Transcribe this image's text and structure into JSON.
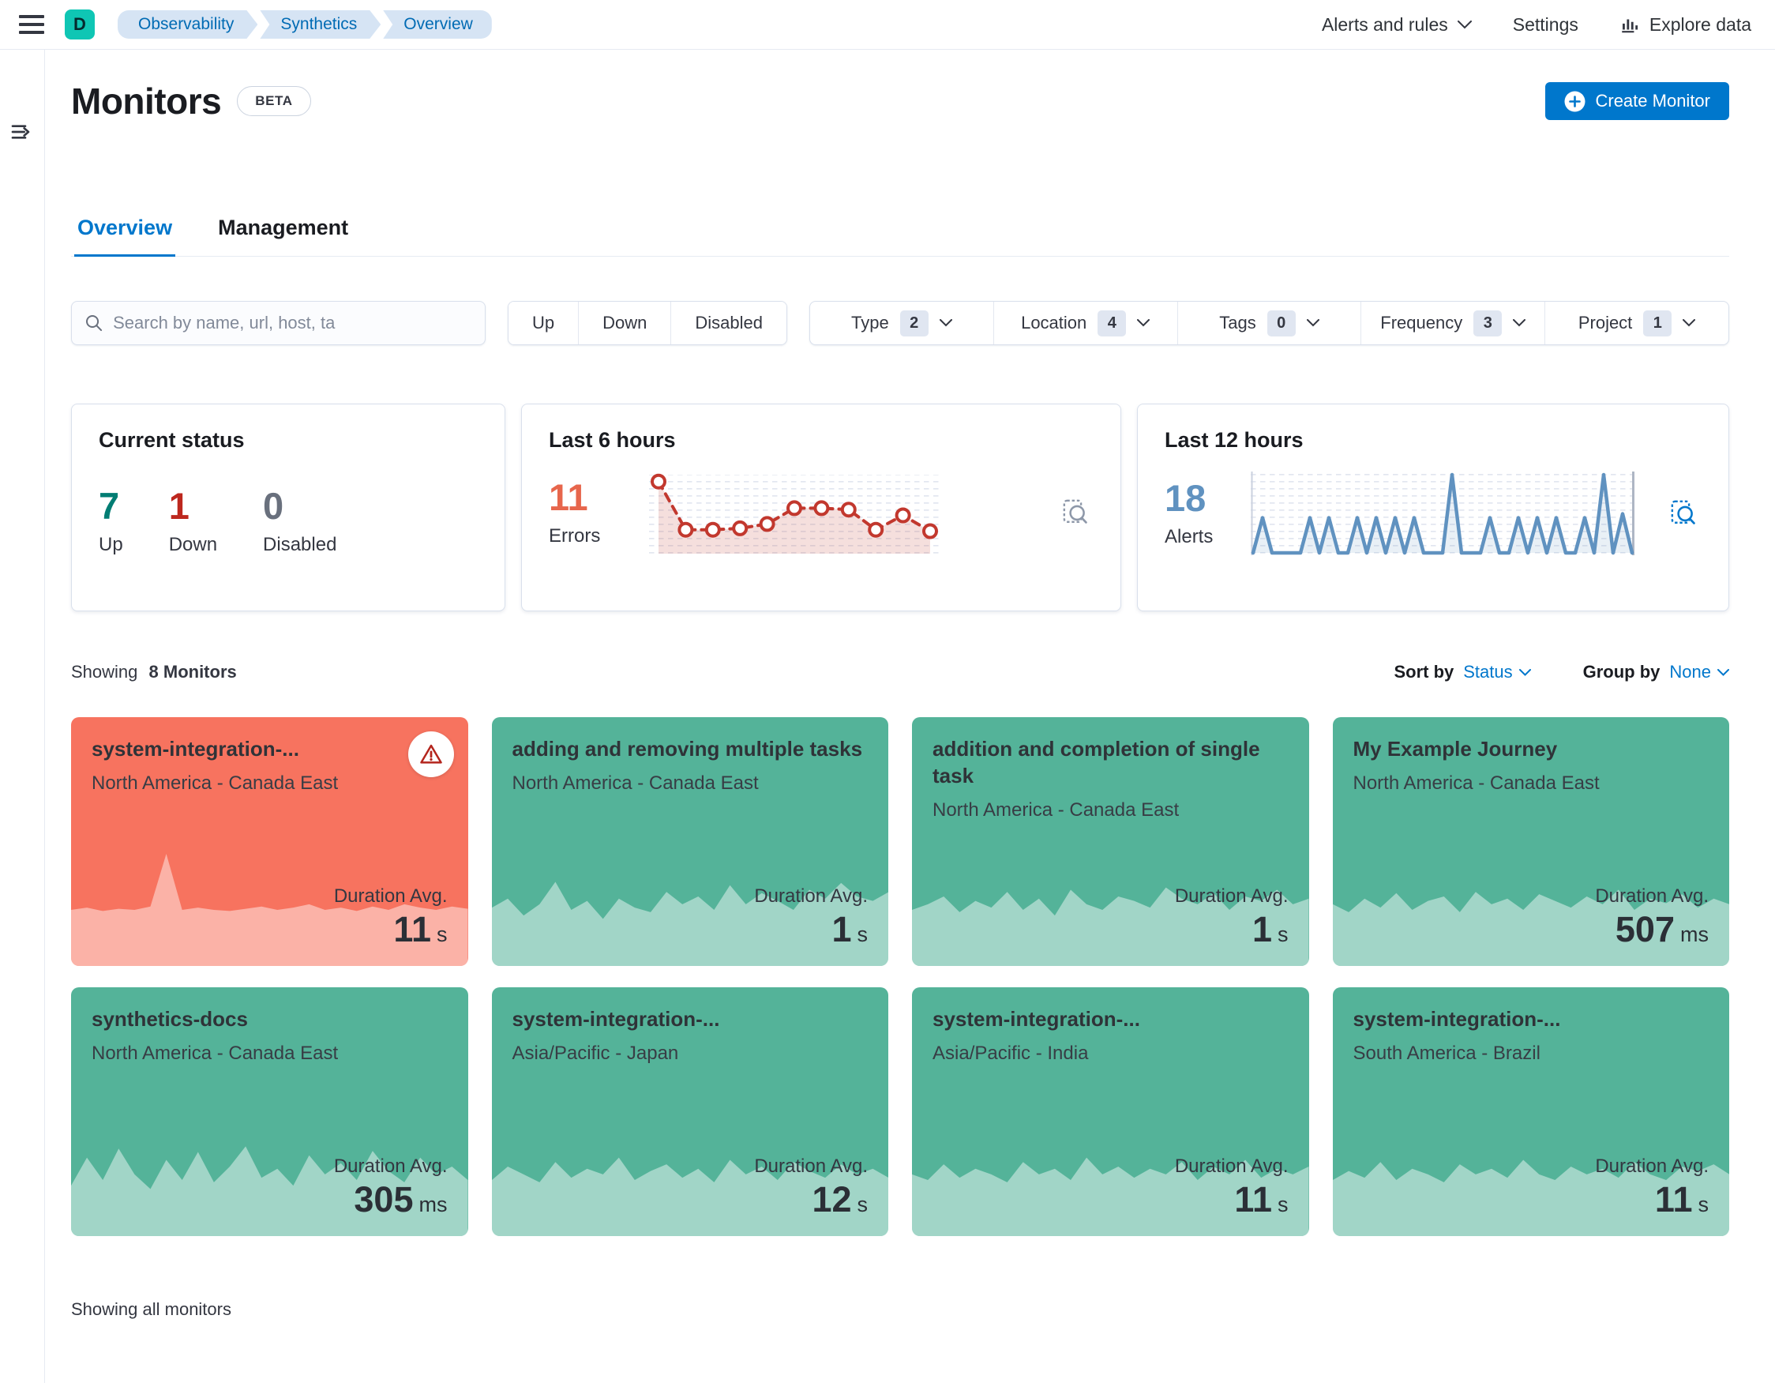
{
  "header": {
    "avatar": "D",
    "breadcrumbs": [
      "Observability",
      "Synthetics",
      "Overview"
    ],
    "nav": {
      "alerts_and_rules": "Alerts and rules",
      "settings": "Settings",
      "explore_data": "Explore data"
    }
  },
  "page": {
    "title": "Monitors",
    "beta_badge": "BETA",
    "create_monitor": "Create Monitor",
    "tabs": {
      "overview": "Overview",
      "management": "Management"
    }
  },
  "toolbar": {
    "search_placeholder": "Search by name, url, host, ta",
    "status_filters": {
      "up": "Up",
      "down": "Down",
      "disabled": "Disabled"
    },
    "dropdown_filters": [
      {
        "label": "Type",
        "count": 2
      },
      {
        "label": "Location",
        "count": 4
      },
      {
        "label": "Tags",
        "count": 0
      },
      {
        "label": "Frequency",
        "count": 3
      },
      {
        "label": "Project",
        "count": 1
      }
    ]
  },
  "stats": {
    "current_status": {
      "title": "Current status",
      "items": [
        {
          "value": "7",
          "label": "Up",
          "color": "#017D73"
        },
        {
          "value": "1",
          "label": "Down",
          "color": "#BD271E"
        },
        {
          "value": "0",
          "label": "Disabled",
          "color": "#69707D"
        }
      ]
    },
    "last6": {
      "title": "Last 6 hours",
      "value": "11",
      "label": "Errors",
      "color": "#E7664C",
      "line_color": "#C2382E",
      "sparkline": [
        0.97,
        0.3,
        0.3,
        0.32,
        0.38,
        0.6,
        0.6,
        0.58,
        0.3,
        0.5,
        0.28
      ]
    },
    "last12": {
      "title": "Last 12 hours",
      "value": "18",
      "label": "Alerts",
      "color": "#6092C0",
      "line_color": "#6092C0",
      "sparkline": [
        0,
        0.45,
        0,
        0,
        0,
        0,
        0.45,
        0,
        0.45,
        0,
        0,
        0.45,
        0,
        0.45,
        0,
        0.45,
        0,
        0.45,
        0,
        0,
        0,
        1,
        0,
        0,
        0,
        0.45,
        0,
        0,
        0.45,
        0,
        0.45,
        0,
        0.45,
        0,
        0,
        0.45,
        0,
        1,
        0,
        0.5,
        0
      ]
    }
  },
  "monitor_list": {
    "showing_prefix": "Showing",
    "showing_bold": "8 Monitors",
    "sort_by_label": "Sort by",
    "sort_by_value": "Status",
    "group_by_label": "Group by",
    "group_by_value": "None",
    "duration_label": "Duration Avg.",
    "footer": "Showing all monitors",
    "cards": [
      {
        "title": "system-integration-...",
        "location": "North America - Canada East",
        "value": "11",
        "unit": "s",
        "status": "down",
        "sparkline": [
          0.5,
          0.52,
          0.49,
          0.51,
          0.5,
          0.53,
          1.0,
          0.5,
          0.52,
          0.5,
          0.49,
          0.51,
          0.53,
          0.5,
          0.52,
          0.55,
          0.5,
          0.52,
          0.49,
          0.53,
          0.5,
          0.55,
          0.52,
          0.5,
          0.53,
          0.51
        ]
      },
      {
        "title": "adding and removing multiple tasks",
        "location": "North America - Canada East",
        "value": "1",
        "unit": "s",
        "status": "up",
        "sparkline": [
          0.52,
          0.6,
          0.45,
          0.55,
          0.75,
          0.5,
          0.58,
          0.42,
          0.6,
          0.52,
          0.48,
          0.66,
          0.55,
          0.62,
          0.5,
          0.72,
          0.55,
          0.65,
          0.58,
          0.5,
          0.68,
          0.6,
          0.74,
          0.62,
          0.58,
          0.66
        ]
      },
      {
        "title": "addition and completion of single task",
        "location": "North America - Canada East",
        "value": "1",
        "unit": "s",
        "status": "up",
        "sparkline": [
          0.5,
          0.55,
          0.62,
          0.48,
          0.58,
          0.52,
          0.66,
          0.5,
          0.6,
          0.45,
          0.68,
          0.55,
          0.5,
          0.62,
          0.58,
          0.52,
          0.7,
          0.6,
          0.55,
          0.65,
          0.5,
          0.62,
          0.58,
          0.68,
          0.55,
          0.6
        ]
      },
      {
        "title": "My Example Journey",
        "location": "North America - Canada East",
        "value": "507",
        "unit": "ms",
        "status": "up",
        "sparkline": [
          0.55,
          0.48,
          0.6,
          0.52,
          0.65,
          0.5,
          0.58,
          0.62,
          0.48,
          0.66,
          0.55,
          0.6,
          0.5,
          0.64,
          0.58,
          0.52,
          0.62,
          0.55,
          0.68,
          0.5,
          0.6,
          0.56,
          0.64,
          0.52,
          0.6,
          0.55
        ]
      },
      {
        "title": "synthetics-docs",
        "location": "North America - Canada East",
        "value": "305",
        "unit": "ms",
        "status": "up",
        "sparkline": [
          0.45,
          0.7,
          0.5,
          0.78,
          0.55,
          0.42,
          0.68,
          0.5,
          0.75,
          0.48,
          0.62,
          0.8,
          0.52,
          0.6,
          0.45,
          0.72,
          0.55,
          0.65,
          0.5,
          0.76,
          0.58,
          0.48,
          0.7,
          0.55,
          0.62,
          0.5
        ]
      },
      {
        "title": "system-integration-...",
        "location": "Asia/Pacific - Japan",
        "value": "12",
        "unit": "s",
        "status": "up",
        "sparkline": [
          0.5,
          0.62,
          0.55,
          0.48,
          0.66,
          0.52,
          0.6,
          0.55,
          0.7,
          0.5,
          0.58,
          0.64,
          0.52,
          0.6,
          0.48,
          0.68,
          0.55,
          0.62,
          0.5,
          0.66,
          0.58,
          0.52,
          0.64,
          0.55,
          0.6,
          0.52
        ]
      },
      {
        "title": "system-integration-...",
        "location": "Asia/Pacific - India",
        "value": "11",
        "unit": "s",
        "status": "up",
        "sparkline": [
          0.55,
          0.5,
          0.64,
          0.52,
          0.6,
          0.55,
          0.48,
          0.66,
          0.55,
          0.6,
          0.5,
          0.7,
          0.55,
          0.62,
          0.52,
          0.6,
          0.55,
          0.66,
          0.5,
          0.62,
          0.55,
          0.68,
          0.52,
          0.6,
          0.55,
          0.62
        ]
      },
      {
        "title": "system-integration-...",
        "location": "South America - Brazil",
        "value": "11",
        "unit": "s",
        "status": "up",
        "sparkline": [
          0.5,
          0.58,
          0.52,
          0.66,
          0.5,
          0.6,
          0.55,
          0.48,
          0.64,
          0.55,
          0.6,
          0.52,
          0.68,
          0.55,
          0.5,
          0.62,
          0.55,
          0.6,
          0.52,
          0.66,
          0.55,
          0.5,
          0.62,
          0.58,
          0.64,
          0.55
        ]
      }
    ]
  },
  "colors": {
    "accent": "#0077CC",
    "up_card": "#54B399",
    "down_card": "#F7735F",
    "up_text": "#017D73",
    "down_text": "#BD271E",
    "disabled_text": "#69707D",
    "errors": "#E7664C",
    "alerts": "#6092C0"
  }
}
